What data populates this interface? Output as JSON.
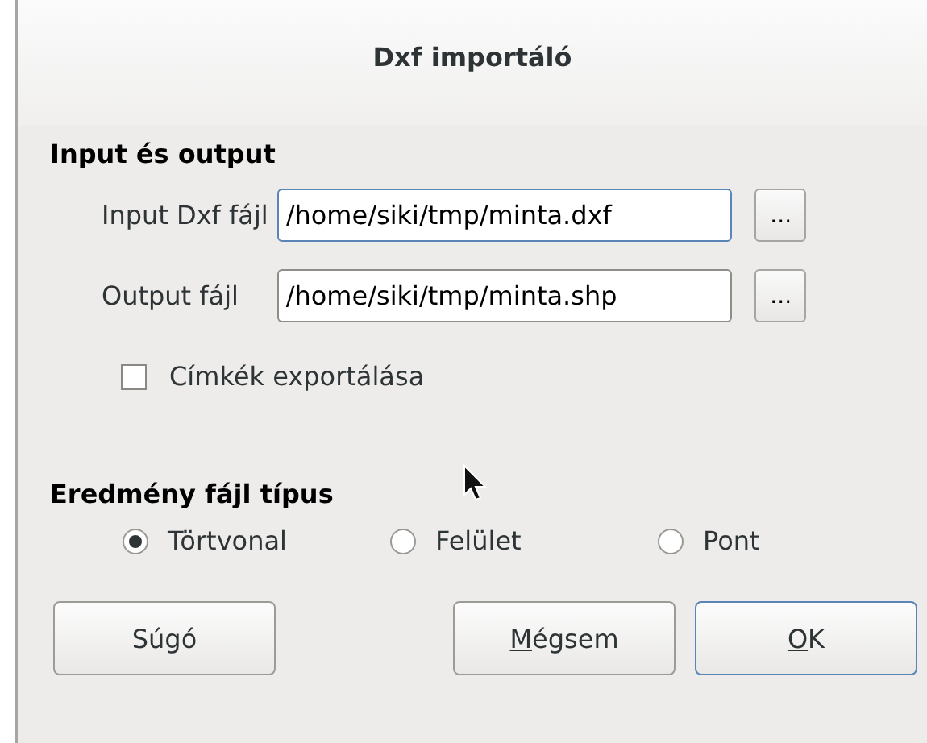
{
  "window": {
    "title": "Dxf importáló"
  },
  "io_section": {
    "heading": "Input és output",
    "fields": [
      {
        "label": "Input Dxf fájl",
        "value": "/home/siki/tmp/minta.dxf",
        "focused": true,
        "browse": "..."
      },
      {
        "label": "Output fájl",
        "value": "/home/siki/tmp/minta.shp",
        "focused": false,
        "browse": "..."
      }
    ],
    "export_labels": {
      "label": "Címkék exportálása",
      "checked": false
    }
  },
  "type_section": {
    "heading": "Eredmény fájl típus",
    "options": [
      {
        "label": "Törtvonal",
        "selected": true
      },
      {
        "label": "Felület",
        "selected": false
      },
      {
        "label": "Pont",
        "selected": false
      }
    ]
  },
  "buttons": [
    {
      "label": "Súgó",
      "underline_first": false,
      "default": false
    },
    {
      "label": "Mégsem",
      "underline_first": true,
      "default": false
    },
    {
      "label": "OK",
      "underline_first": true,
      "default": true
    }
  ]
}
